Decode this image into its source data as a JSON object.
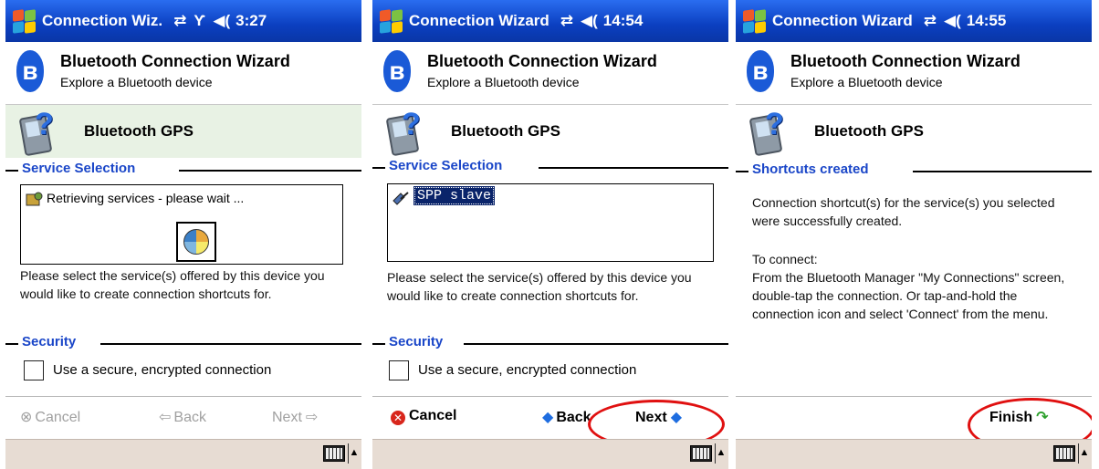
{
  "screens": [
    {
      "title": "Connection Wiz.",
      "clock": "3:27",
      "wizard_title": "Bluetooth Connection Wizard",
      "wizard_subtitle": "Explore a Bluetooth device",
      "device_name": "Bluetooth GPS",
      "section1": "Service Selection",
      "list_status": "Retrieving services - please wait ...",
      "instructions": "Please select the service(s) offered by this device you would like to create connection shortcuts for.",
      "section2": "Security",
      "checkbox_label": "Use a secure, encrypted connection",
      "cancel": "Cancel",
      "back": "Back",
      "next": "Next"
    },
    {
      "title": "Connection Wizard",
      "clock": "14:54",
      "wizard_title": "Bluetooth Connection Wizard",
      "wizard_subtitle": "Explore a Bluetooth device",
      "device_name": "Bluetooth GPS",
      "section1": "Service Selection",
      "list_item": "SPP slave",
      "instructions": "Please select the service(s) offered by this device you would like to create connection shortcuts for.",
      "section2": "Security",
      "checkbox_label": "Use a secure, encrypted connection",
      "cancel": "Cancel",
      "back": "Back",
      "next": "Next"
    },
    {
      "title": "Connection Wizard",
      "clock": "14:55",
      "wizard_title": "Bluetooth Connection Wizard",
      "wizard_subtitle": "Explore a Bluetooth device",
      "device_name": "Bluetooth GPS",
      "section1": "Shortcuts created",
      "message1": "Connection shortcut(s)  for the service(s) you selected were successfully created.",
      "message2": "To connect:\nFrom the Bluetooth Manager \"My Connections\" screen, double-tap the connection. Or tap-and-hold the connection icon and select 'Connect' from the menu.",
      "finish": "Finish"
    }
  ],
  "icons": {
    "start": "windows-flag-icon",
    "connectivity": "connectivity-arrows-icon",
    "signal": "antenna-icon",
    "volume": "speaker-icon",
    "bluetooth": "bluetooth-icon",
    "device": "unknown-device-icon",
    "keyboard": "keyboard-icon"
  },
  "colors": {
    "titlebar": "#0b3fc0",
    "section_label": "#1a46c8",
    "annotation": "#e01010",
    "taskbar": "#e7dcd3"
  }
}
